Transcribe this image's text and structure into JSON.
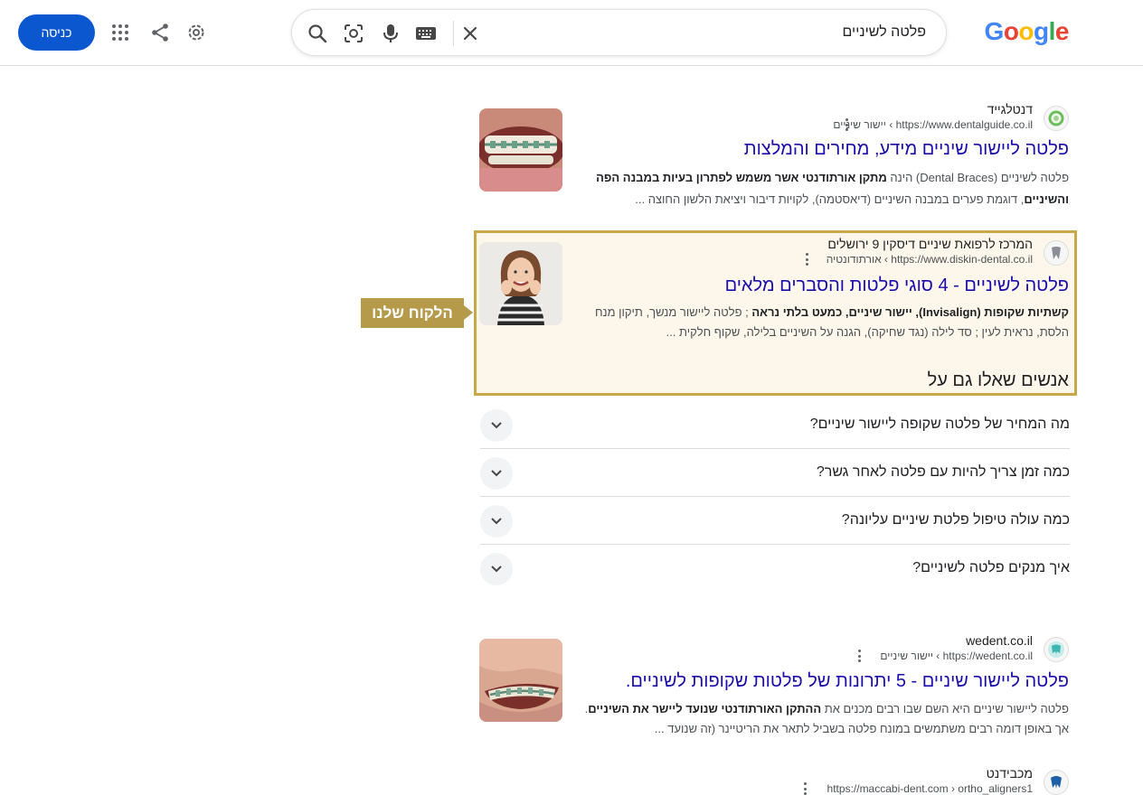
{
  "header": {
    "logo_text": "Google",
    "search_query": "פלטה לשיניים",
    "login_label": "כניסה",
    "icons": [
      "search-icon",
      "lens-icon",
      "mic-icon",
      "keyboard-icon",
      "clear-icon",
      "apps-icon",
      "share-icon",
      "settings-icon"
    ],
    "accent_color": "#0b57d0"
  },
  "results": [
    {
      "site_name": "דנטלגייד",
      "url": "https://www.dentalguide.co.il › יישור שיניים",
      "title": "פלטה ליישור שיניים מידע, מחירים והמלצות",
      "snippet_line1_a": "פלטה לשיניים (Dental Braces) הינה ",
      "snippet_line1_b": "מתקן אורתודנטי אשר משמש לפתרון בעיות במבנה הפה",
      "snippet_line2_a": "והשיניים",
      "snippet_line2_b": ", דוגמת פערים במבנה השיניים (דיאסטמה), לקויות דיבור ויציאת הלשון החוצה ..."
    },
    {
      "site_name": "המרכז לרפואת שיניים דיסקין 9 ירושלים",
      "url": "https://www.diskin-dental.co.il › אורתודונטיה",
      "title": "פלטה לשיניים - 4 סוגי פלטות והסברים מלאים",
      "snippet_line1_a": "קשתיות שקופות (Invisalign), יישור שיניים, כמעט בלתי נראה",
      "snippet_line1_b": " ; פלטה ליישור מנשך, תיקון מנח",
      "snippet_line2": "הלסת, נראית לעין ; סד לילה (נגד שחיקה), הגנה על השיניים בלילה, שקוף חלקית ..."
    },
    {
      "site_name": "wedent.co.il",
      "url": "https://wedent.co.il › יישור שיניים",
      "title": "פלטה ליישור שיניים - 5 יתרונות של פלטות שקופות לשיניים.",
      "snippet_line1_a": "פלטה ליישור שיניים היא השם שבו רבים מכנים את ",
      "snippet_line1_b": "ההתקן האורתודנטי שנועד ליישר את השיניים",
      "snippet_line1_c": ".",
      "snippet_line2": "אך באופן דומה רבים משתמשים במונח פלטה בשביל לתאר את הריטיינר (זה שנועד ..."
    },
    {
      "site_name": "מכבידנט",
      "url": "https://maccabi-dent.com › ortho_aligners1"
    }
  ],
  "highlight": {
    "tag_label": "הלקוח שלנו",
    "border_color": "#c7a94a",
    "tag_color": "#b59a49"
  },
  "people_also_ask": {
    "title": "אנשים שאלו גם על",
    "questions": [
      "מה המחיר של פלטה שקופה ליישור שיניים?",
      "כמה זמן צריך להיות עם פלטה לאחר גשר?",
      "כמה עולה טיפול פלטת שיניים עליונה?",
      "איך מנקים פלטה לשיניים?"
    ]
  }
}
